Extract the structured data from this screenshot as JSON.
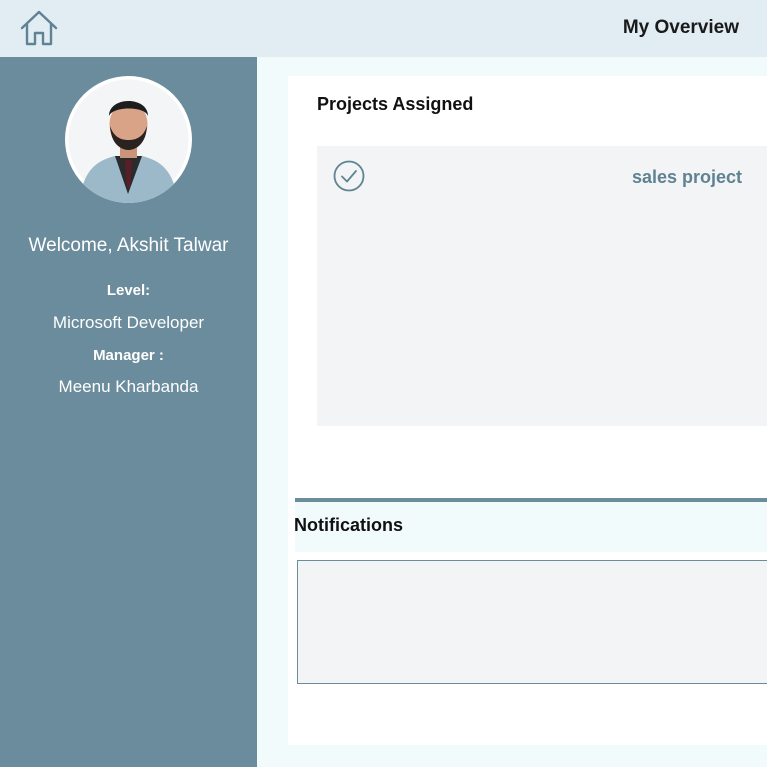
{
  "header": {
    "home_icon": "home-icon",
    "title": "My Overview"
  },
  "profile": {
    "avatar": "avatar",
    "welcome": "Welcome, Akshit Talwar",
    "level_label": "Level:",
    "level_value": "Microsoft Developer",
    "manager_label": "Manager :",
    "manager_value": "Meenu Kharbanda"
  },
  "projects": {
    "heading": "Projects Assigned",
    "items": [
      {
        "name": "sales project",
        "icon": "check-circle-icon"
      }
    ]
  },
  "notifications": {
    "heading": "Notifications"
  },
  "colors": {
    "sidebar": "#6b8c9c",
    "topbar": "#e1ecf3",
    "accent_text": "#5f8392",
    "panel": "#f2f4f5"
  }
}
